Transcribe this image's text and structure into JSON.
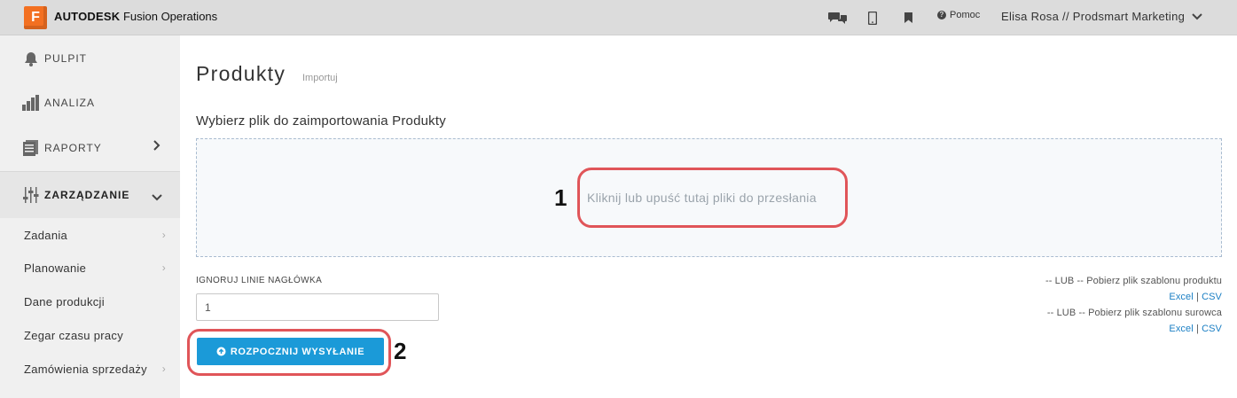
{
  "topbar": {
    "logo_letter": "F",
    "brand_bold": "AUTODESK",
    "brand_rest": "Fusion Operations",
    "help_label": "Pomoc",
    "user_label": "Elisa Rosa // Prodsmart Marketing"
  },
  "sidebar": {
    "main_items": [
      {
        "label": "PULPIT",
        "icon": "bell-icon"
      },
      {
        "label": "ANALIZA",
        "icon": "bar-chart-icon"
      },
      {
        "label": "RAPORTY",
        "icon": "report-icon"
      },
      {
        "label": "ZARZĄDZANIE",
        "icon": "sliders-icon"
      }
    ],
    "sub_items": [
      {
        "label": "Zadania"
      },
      {
        "label": "Planowanie"
      },
      {
        "label": "Dane produkcji"
      },
      {
        "label": "Zegar czasu pracy"
      },
      {
        "label": "Zamówienia sprzedaży"
      }
    ]
  },
  "main": {
    "title": "Produkty",
    "subtitle": "Importuj",
    "choose_label": "Wybierz plik do zaimportowania Produkty",
    "dropzone_text": "Kliknij lub upuść tutaj pliki do przesłania",
    "ignore_label": "IGNORUJ LINIE NAGŁÓWKA",
    "ignore_value": "1",
    "start_button": "ROZPOCZNIJ WYSYŁANIE",
    "product_template_text": "-- LUB -- Pobierz plik szablonu produktu",
    "material_template_text": "-- LUB -- Pobierz plik szablonu surowca",
    "excel_label": "Excel",
    "csv_label": "CSV",
    "separator": "|"
  },
  "annotations": {
    "marker_1": "1",
    "marker_2": "2"
  },
  "colors": {
    "accent": "#1b9ad8",
    "logo": "#f37021",
    "highlight_ring": "#e05559"
  }
}
